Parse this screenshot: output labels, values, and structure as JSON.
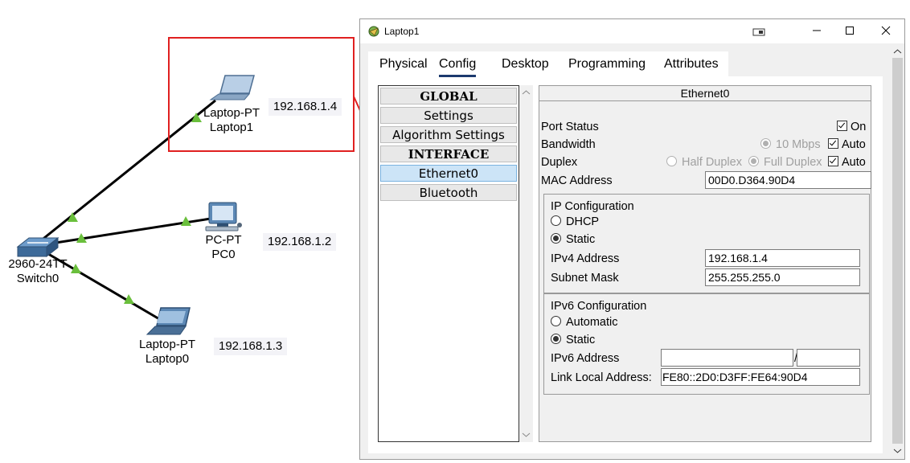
{
  "topology": {
    "devices": [
      {
        "id": "laptop1",
        "type": "Laptop-PT",
        "name": "Laptop1",
        "ip": "192.168.1.4"
      },
      {
        "id": "pc0",
        "type": "PC-PT",
        "name": "PC0",
        "ip": "192.168.1.2"
      },
      {
        "id": "laptop0",
        "type": "Laptop-PT",
        "name": "Laptop0",
        "ip": "192.168.1.3"
      },
      {
        "id": "switch0",
        "type": "2960-24TT",
        "name": "Switch0"
      }
    ],
    "link_color": "#000000",
    "link_status_color": "#6abf3c",
    "highlight_color": "#e02020"
  },
  "window": {
    "title": "Laptop1",
    "tabs": [
      "Physical",
      "Config",
      "Desktop",
      "Programming",
      "Attributes"
    ],
    "active_tab": "Config",
    "left_panel": [
      {
        "label": "GLOBAL",
        "header": true
      },
      {
        "label": "Settings"
      },
      {
        "label": "Algorithm Settings"
      },
      {
        "label": "INTERFACE",
        "header": true
      },
      {
        "label": "Ethernet0",
        "selected": true
      },
      {
        "label": "Bluetooth"
      }
    ],
    "interface": {
      "title": "Ethernet0",
      "port_status_label": "Port Status",
      "port_on_label": "On",
      "bandwidth_label": "Bandwidth",
      "bandwidth_option": "10 Mbps",
      "auto_label": "Auto",
      "duplex_label": "Duplex",
      "half_duplex": "Half Duplex",
      "full_duplex": "Full Duplex",
      "mac_label": "MAC Address",
      "mac_value": "00D0.D364.90D4",
      "ip_config_title": "IP Configuration",
      "dhcp_label": "DHCP",
      "static_label": "Static",
      "ipv4_label": "IPv4 Address",
      "ipv4_value": "192.168.1.4",
      "subnet_label": "Subnet Mask",
      "subnet_value": "255.255.255.0",
      "ipv6_config_title": "IPv6 Configuration",
      "automatic_label": "Automatic",
      "ipv6_static_label": "Static",
      "ipv6_label": "IPv6 Address",
      "ipv6_value": "",
      "ipv6_prefix": "",
      "slash": "/",
      "link_local_label": "Link Local Address:",
      "link_local_value": "FE80::2D0:D3FF:FE64:90D4"
    }
  }
}
